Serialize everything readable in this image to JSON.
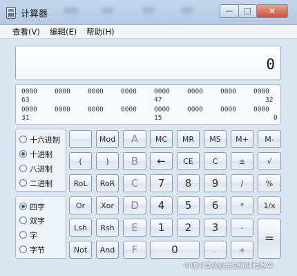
{
  "window": {
    "title": "计算器"
  },
  "title_controls": {
    "minimize": "—",
    "maximize": "□",
    "close": "✕"
  },
  "menu": [
    "查看(V)",
    "编辑(E)",
    "帮助(H)"
  ],
  "display": {
    "value": "0"
  },
  "bits": {
    "row1": [
      "0000",
      "0000",
      "0000",
      "0000",
      "0000",
      "0000",
      "0000",
      "0000"
    ],
    "row1_labels": [
      "63",
      "47",
      "32"
    ],
    "row2": [
      "0000",
      "0000",
      "0000",
      "0000",
      "0000",
      "0000",
      "0000",
      "0000"
    ],
    "row2_labels": [
      "31",
      "15",
      "0"
    ]
  },
  "base_modes": {
    "options": [
      "十六进制",
      "十进制",
      "八进制",
      "二进制"
    ],
    "selected": "十进制"
  },
  "word_sizes": {
    "options": [
      "四字",
      "双字",
      "字",
      "字节"
    ],
    "selected": "四字"
  },
  "buttons": [
    [
      "",
      "Mod",
      "A",
      "MC",
      "MR",
      "MS",
      "M+",
      "M-"
    ],
    [
      "(",
      ")",
      "B",
      "←",
      "CE",
      "C",
      "±",
      "√"
    ],
    [
      "RoL",
      "RoR",
      "C",
      "7",
      "8",
      "9",
      "/",
      "%"
    ],
    [
      "Or",
      "Xor",
      "D",
      "4",
      "5",
      "6",
      "*",
      "1/x"
    ],
    [
      "Lsh",
      "Rsh",
      "E",
      "1",
      "2",
      "3",
      "-",
      "="
    ],
    [
      "Not",
      "And",
      "F",
      "0",
      ".",
      "+"
    ]
  ],
  "watermark": "中职计算机应用基础课程教学"
}
